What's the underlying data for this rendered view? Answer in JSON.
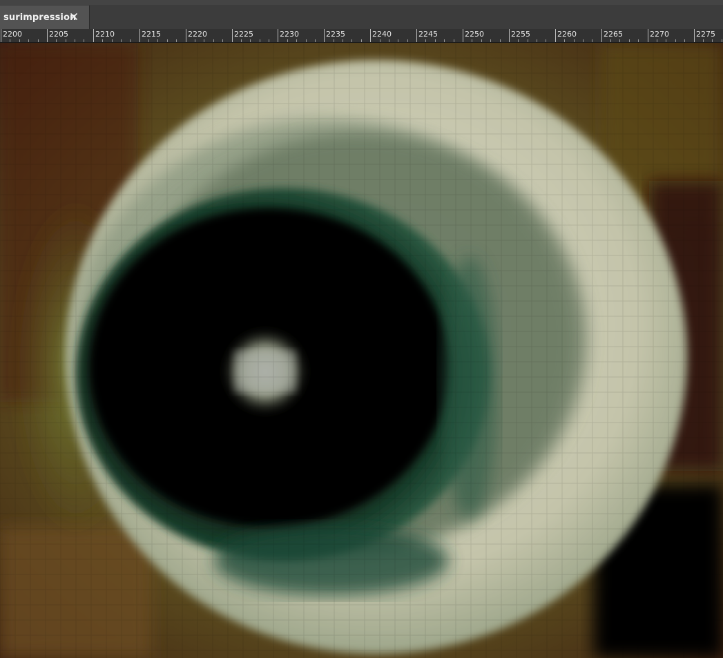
{
  "document_tab": {
    "title": "surimpression",
    "close_icon": "close-icon"
  },
  "ruler": {
    "orientation": "horizontal",
    "labels": [
      "2200",
      "2205",
      "2210",
      "2215",
      "2220",
      "2225",
      "2230",
      "2235",
      "2240",
      "2245",
      "2250",
      "2255",
      "2260",
      "2265",
      "2270",
      "2275"
    ]
  },
  "colors": {
    "chrome_dark": "#3c3c3c",
    "tab_active": "#535353",
    "ruler_bg": "#323232",
    "ruler_text": "#e6e6e6"
  }
}
